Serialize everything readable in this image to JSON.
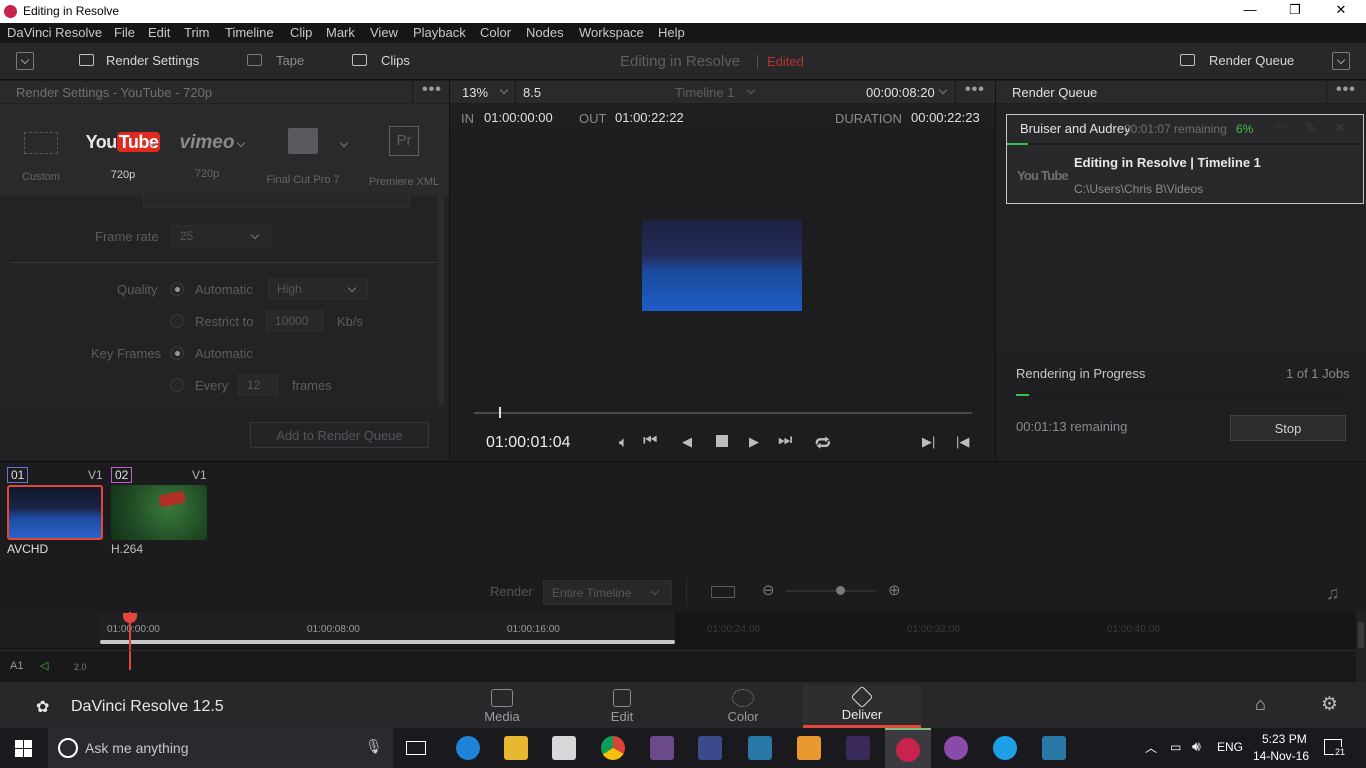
{
  "window": {
    "title": "Editing in Resolve",
    "minimize": "—",
    "maximize": "❐",
    "close": "✕"
  },
  "menu": [
    "DaVinci Resolve",
    "File",
    "Edit",
    "Trim",
    "Timeline",
    "Clip",
    "Mark",
    "View",
    "Playback",
    "Color",
    "Nodes",
    "Workspace",
    "Help"
  ],
  "toolbar": {
    "render_settings": "Render Settings",
    "tape": "Tape",
    "clips": "Clips",
    "project_title": "Editing in Resolve",
    "project_status": "Edited",
    "render_queue": "Render Queue"
  },
  "render_settings": {
    "header": "Render Settings - YouTube - 720p",
    "presets": [
      {
        "name": "Custom",
        "sub": ""
      },
      {
        "name": "YouTube",
        "sub": "720p"
      },
      {
        "name": "vimeo",
        "sub": "720p"
      },
      {
        "name": "Final Cut Pro 7",
        "sub": ""
      },
      {
        "name": "Premiere XML",
        "sub": ""
      }
    ],
    "premiere_logo": "Pr",
    "frame_rate_label": "Frame rate",
    "frame_rate_value": "25",
    "quality_label": "Quality",
    "quality_auto": "Automatic",
    "quality_level": "High",
    "restrict_label": "Restrict to",
    "restrict_value": "10000",
    "restrict_unit": "Kb/s",
    "keyframes_label": "Key Frames",
    "keyframes_auto": "Automatic",
    "every_label": "Every",
    "every_value": "12",
    "every_unit": "frames",
    "add_button": "Add to Render Queue"
  },
  "viewer": {
    "zoom": "13%",
    "zoom_value2": "8.5",
    "timeline_name": "Timeline 1",
    "timecode_top": "00:00:08:20",
    "in_label": "IN",
    "in_value": "01:00:00:00",
    "out_label": "OUT",
    "out_value": "01:00:22:22",
    "duration_label": "DURATION",
    "duration_value": "00:00:22:23",
    "playhead_timecode": "01:00:01:04"
  },
  "render_queue": {
    "title": "Render Queue",
    "job_name": "Bruiser and Audrey",
    "job_remaining": "00:01:07 remaining",
    "job_percent": "6%",
    "job_timeline": "Editing in Resolve | Timeline 1",
    "job_path": "C:\\Users\\Chris B\\Videos",
    "job_logo": "You Tube",
    "progress_title": "Rendering in Progress",
    "progress_count": "1 of 1 Jobs",
    "progress_remaining": "00:01:13 remaining",
    "stop_button": "Stop"
  },
  "clips": [
    {
      "num": "01",
      "track": "V1",
      "codec": "AVCHD"
    },
    {
      "num": "02",
      "track": "V1",
      "codec": "H.264"
    }
  ],
  "render_bar": {
    "label": "Render",
    "mode": "Entire Timeline"
  },
  "timeline": {
    "ticks": [
      "01:00:00:00",
      "01:00:08:00",
      "01:00:16:00",
      "01:00:24:00",
      "01:00:32:00",
      "01:00:40:00"
    ],
    "track_label": "A1",
    "track_level": "2.0"
  },
  "pagenav": {
    "app_name": "DaVinci Resolve 12.5",
    "pages": [
      "Media",
      "Edit",
      "Color",
      "Deliver"
    ],
    "active": "Deliver"
  },
  "taskbar": {
    "search_placeholder": "Ask me anything",
    "lang": "ENG",
    "time": "5:23 PM",
    "date": "14-Nov-16",
    "notification_count": "21"
  },
  "colors": {
    "accent_red": "#e4463a",
    "progress_green": "#3dbd4b",
    "youtube_red": "#e02a20"
  }
}
